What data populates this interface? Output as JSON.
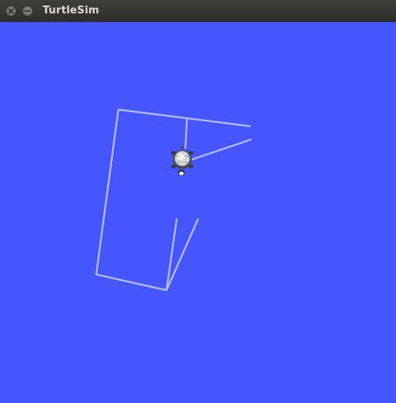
{
  "window": {
    "title": "TurtleSim",
    "controls": [
      {
        "name": "close",
        "icon": "close-icon"
      },
      {
        "name": "minimize",
        "icon": "minimize-icon"
      }
    ]
  },
  "canvas": {
    "background": "#4556ff",
    "pen_color": "#b8c0f2",
    "turtle": {
      "icon": "turtle-icon"
    }
  }
}
